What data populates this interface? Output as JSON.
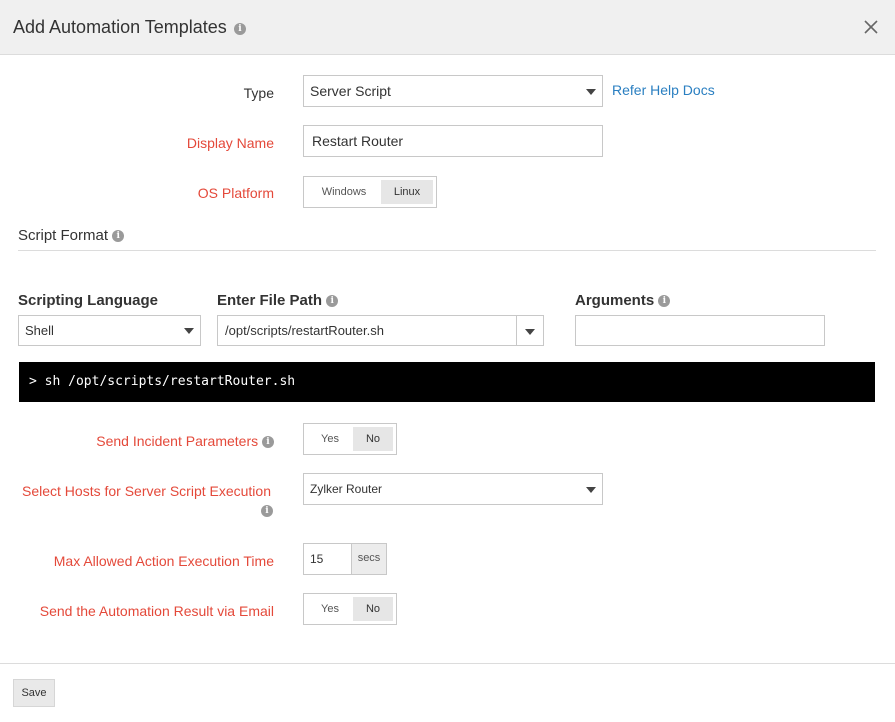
{
  "header": {
    "title": "Add Automation Templates",
    "info_icon": "info-icon",
    "close_icon": "close-icon"
  },
  "form": {
    "type": {
      "label": "Type",
      "value": "Server Script",
      "help_link": "Refer Help Docs"
    },
    "display_name": {
      "label": "Display Name",
      "value": "Restart Router"
    },
    "os_platform": {
      "label": "OS Platform",
      "options": [
        "Windows",
        "Linux"
      ],
      "selected": "Linux"
    }
  },
  "script_format": {
    "title": "Script Format",
    "scripting_language": {
      "label": "Scripting Language",
      "value": "Shell"
    },
    "file_path": {
      "label": "Enter File Path",
      "value": "/opt/scripts/restartRouter.sh"
    },
    "arguments": {
      "label": "Arguments",
      "value": ""
    },
    "preview": "> sh /opt/scripts/restartRouter.sh"
  },
  "options": {
    "send_incident_params": {
      "label": "Send Incident Parameters",
      "options": [
        "Yes",
        "No"
      ],
      "selected": "No"
    },
    "select_hosts": {
      "label": "Select Hosts for Server Script Execution",
      "value": "Zylker Router"
    },
    "max_time": {
      "label": "Max Allowed Action Execution Time",
      "value": "15",
      "unit": "secs"
    },
    "send_email": {
      "label": "Send the Automation Result via Email",
      "options": [
        "Yes",
        "No"
      ],
      "selected": "No"
    }
  },
  "footer": {
    "save_label": "Save"
  },
  "colors": {
    "required_label": "#e4493a",
    "link": "#2a7fc1",
    "terminal_bg": "#000000"
  }
}
